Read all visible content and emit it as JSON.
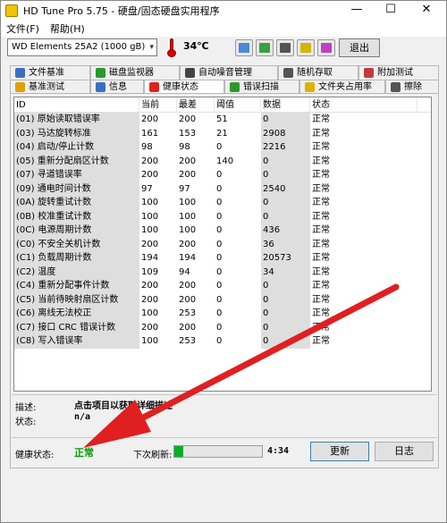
{
  "window": {
    "title": "HD Tune Pro 5.75 - 硬盘/固态硬盘实用程序"
  },
  "menu": {
    "items": [
      "文件(F)",
      "帮助(H)"
    ]
  },
  "toolbar": {
    "drive": "WD     Elements 25A2 (1000 gB)",
    "temperature": "34℃",
    "exit_label": "退出"
  },
  "tabs_top": [
    {
      "label": "文件基准",
      "icon": "file-benchmark-icon",
      "color": "#3a6fc4"
    },
    {
      "label": "磁盘监视器",
      "icon": "disk-monitor-icon",
      "color": "#2a9a2a"
    },
    {
      "label": "自动噪音管理",
      "icon": "speaker-icon",
      "color": "#444444"
    },
    {
      "label": "随机存取",
      "icon": "random-access-icon",
      "color": "#555555"
    },
    {
      "label": "附加测试",
      "icon": "extra-tests-icon",
      "color": "#c43a3a"
    }
  ],
  "tabs_bottom": [
    {
      "label": "基准测试",
      "icon": "benchmark-icon",
      "color": "#e0a000"
    },
    {
      "label": "信息",
      "icon": "info-icon",
      "color": "#3a6fc4"
    },
    {
      "label": "健康状态",
      "icon": "health-cross-icon",
      "color": "#e02020",
      "active": true
    },
    {
      "label": "错误扫描",
      "icon": "error-scan-icon",
      "color": "#2a9a2a"
    },
    {
      "label": "文件夹占用率",
      "icon": "folder-usage-icon",
      "color": "#e0b000"
    },
    {
      "label": "擦除",
      "icon": "erase-icon",
      "color": "#555555"
    }
  ],
  "table": {
    "headers": [
      "ID",
      "当前",
      "最差",
      "阈值",
      "数据",
      "状态"
    ],
    "rows": [
      [
        "(01) 原始读取错误率",
        "200",
        "200",
        "51",
        "0",
        "正常"
      ],
      [
        "(03) 马达旋转标准",
        "161",
        "153",
        "21",
        "2908",
        "正常"
      ],
      [
        "(04) 启动/停止计数",
        "98",
        "98",
        "0",
        "2216",
        "正常"
      ],
      [
        "(05) 重新分配扇区计数",
        "200",
        "200",
        "140",
        "0",
        "正常"
      ],
      [
        "(07) 寻道错误率",
        "200",
        "200",
        "0",
        "0",
        "正常"
      ],
      [
        "(09) 通电时间计数",
        "97",
        "97",
        "0",
        "2540",
        "正常"
      ],
      [
        "(0A) 旋转重试计数",
        "100",
        "100",
        "0",
        "0",
        "正常"
      ],
      [
        "(0B) 校准重试计数",
        "100",
        "100",
        "0",
        "0",
        "正常"
      ],
      [
        "(0C) 电源周期计数",
        "100",
        "100",
        "0",
        "436",
        "正常"
      ],
      [
        "(C0) 不安全关机计数",
        "200",
        "200",
        "0",
        "36",
        "正常"
      ],
      [
        "(C1) 负载周期计数",
        "194",
        "194",
        "0",
        "20573",
        "正常"
      ],
      [
        "(C2) 温度",
        "109",
        "94",
        "0",
        "34",
        "正常"
      ],
      [
        "(C4) 重新分配事件计数",
        "200",
        "200",
        "0",
        "0",
        "正常"
      ],
      [
        "(C5) 当前待映射扇区计数",
        "200",
        "200",
        "0",
        "0",
        "正常"
      ],
      [
        "(C6) 离线无法校正",
        "100",
        "253",
        "0",
        "0",
        "正常"
      ],
      [
        "(C7) 接口 CRC 错误计数",
        "200",
        "200",
        "0",
        "0",
        "正常"
      ],
      [
        "(C8) 写入错误率",
        "100",
        "253",
        "0",
        "0",
        "正常"
      ]
    ]
  },
  "details": {
    "desc_label": "描述:",
    "desc_value": "点击项目以获取详细描述",
    "status_label": "状态:",
    "status_value": "n/a"
  },
  "footer": {
    "health_label": "健康状态:",
    "health_value": "正常",
    "health_color": "#00a000",
    "refresh_label": "下次刷新:",
    "refresh_progress": 0.1,
    "countdown": "4:34",
    "update_label": "更新",
    "log_label": "日志"
  },
  "annotation": {
    "arrow_color": "#e02020"
  }
}
